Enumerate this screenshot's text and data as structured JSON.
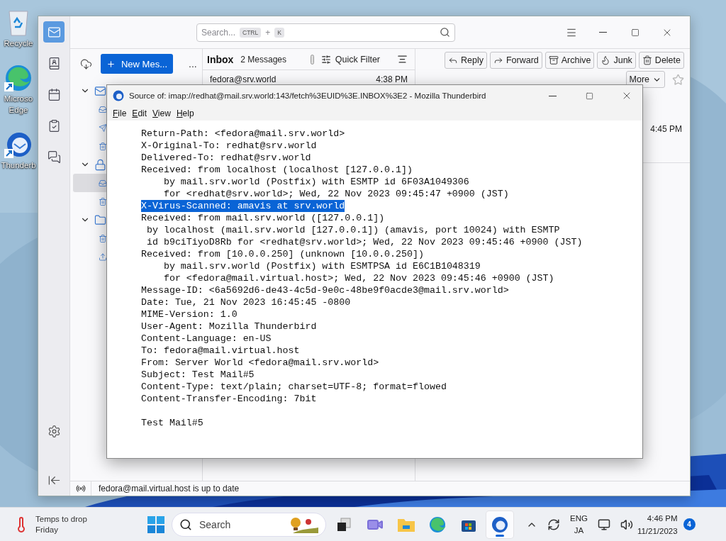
{
  "desktop_icons": [
    {
      "kind": "recycle",
      "lines": [
        "Recycle"
      ]
    },
    {
      "kind": "edge",
      "lines": [
        "Microso",
        "Edge"
      ]
    },
    {
      "kind": "thunderbird",
      "lines": [
        "Thunderb"
      ]
    }
  ],
  "main_window": {
    "spaces": [
      {
        "kind": "mail",
        "selected": true
      },
      {
        "kind": "address-book",
        "selected": false
      },
      {
        "kind": "calendar",
        "selected": false
      },
      {
        "kind": "tasks",
        "selected": false
      },
      {
        "kind": "chat",
        "selected": false
      }
    ],
    "search": {
      "placeholder": "Search...",
      "shortcut": [
        "CTRL",
        "+",
        "K"
      ]
    },
    "new_message": "New Mes...",
    "more": "...",
    "folders": [
      {
        "kind": "account",
        "expanded": true,
        "children": [
          {
            "kind": "inbox",
            "selected": false
          },
          {
            "kind": "sent",
            "selected": false
          },
          {
            "kind": "trash",
            "selected": false
          }
        ]
      },
      {
        "kind": "secure-account",
        "expanded": true,
        "children": [
          {
            "kind": "inbox",
            "selected": true
          },
          {
            "kind": "trash",
            "selected": false
          }
        ]
      },
      {
        "kind": "local-folders",
        "expanded": true,
        "children": [
          {
            "kind": "trash",
            "selected": false
          },
          {
            "kind": "outbox",
            "selected": false
          }
        ]
      }
    ],
    "list": {
      "title": "Inbox",
      "count": "2 Messages",
      "quick_filter": "Quick Filter",
      "quick_filter_on": false,
      "rows": [
        {
          "from": "fedora@srv.world",
          "time": "4:38 PM"
        }
      ]
    },
    "actions": [
      {
        "kind": "reply",
        "label": "Reply"
      },
      {
        "kind": "forward",
        "label": "Forward"
      },
      {
        "kind": "archive",
        "label": "Archive"
      },
      {
        "kind": "junk",
        "label": "Junk"
      },
      {
        "kind": "delete",
        "label": "Delete"
      }
    ],
    "more_menu": "More",
    "starred": false,
    "date": "4:45 PM",
    "status": "fedora@mail.virtual.host is up to date"
  },
  "dialog": {
    "title": "Source of: imap://redhat@mail.srv.world:143/fetch%3EUID%3E.INBOX%3E2 - Mozilla Thunderbird",
    "menu": [
      "File",
      "Edit",
      "View",
      "Help"
    ],
    "headers": [
      {
        "text": "Return-Path: <fedora@mail.srv.world>",
        "selected": false
      },
      {
        "text": "X-Original-To: redhat@srv.world",
        "selected": false
      },
      {
        "text": "Delivered-To: redhat@srv.world",
        "selected": false
      },
      {
        "text": "Received: from localhost (localhost [127.0.0.1])",
        "selected": false
      },
      {
        "text": "    by mail.srv.world (Postfix) with ESMTP id 6F03A1049306",
        "selected": false
      },
      {
        "text": "    for <redhat@srv.world>; Wed, 22 Nov 2023 09:45:47 +0900 (JST)",
        "selected": false
      },
      {
        "text": "X-Virus-Scanned: amavis at srv.world",
        "selected": true
      },
      {
        "text": "Received: from mail.srv.world ([127.0.0.1])",
        "selected": false
      },
      {
        "text": " by localhost (mail.srv.world [127.0.0.1]) (amavis, port 10024) with ESMTP",
        "selected": false
      },
      {
        "text": " id b9ciTiyoD8Rb for <redhat@srv.world>; Wed, 22 Nov 2023 09:45:46 +0900 (JST)",
        "selected": false
      },
      {
        "text": "Received: from [10.0.0.250] (unknown [10.0.0.250])",
        "selected": false
      },
      {
        "text": "    by mail.srv.world (Postfix) with ESMTPSA id E6C1B1048319",
        "selected": false
      },
      {
        "text": "    for <fedora@mail.virtual.host>; Wed, 22 Nov 2023 09:45:46 +0900 (JST)",
        "selected": false
      },
      {
        "text": "Message-ID: <6a5692d6-de43-4c5d-9e0c-48be9f0acde3@mail.srv.world>",
        "selected": false
      },
      {
        "text": "Date: Tue, 21 Nov 2023 16:45:45 -0800",
        "selected": false
      },
      {
        "text": "MIME-Version: 1.0",
        "selected": false
      },
      {
        "text": "User-Agent: Mozilla Thunderbird",
        "selected": false
      },
      {
        "text": "Content-Language: en-US",
        "selected": false
      },
      {
        "text": "To: fedora@mail.virtual.host",
        "selected": false
      },
      {
        "text": "From: Server World <fedora@mail.srv.world>",
        "selected": false
      },
      {
        "text": "Subject: Test Mail#5",
        "selected": false
      },
      {
        "text": "Content-Type: text/plain; charset=UTF-8; format=flowed",
        "selected": false
      },
      {
        "text": "Content-Transfer-Encoding: 7bit",
        "selected": false
      }
    ],
    "body": [
      {
        "text": "Test Mail#5",
        "selected": false
      }
    ]
  },
  "taskbar": {
    "weather": [
      "Temps to drop",
      "Friday"
    ],
    "search_placeholder": "Search",
    "apps": [
      {
        "kind": "task-view",
        "selected": false
      },
      {
        "kind": "meet",
        "selected": false
      },
      {
        "kind": "explorer",
        "selected": false
      },
      {
        "kind": "edge",
        "selected": false
      },
      {
        "kind": "store",
        "selected": false
      },
      {
        "kind": "thunderbird",
        "selected": true
      }
    ],
    "language": [
      "ENG",
      "JA"
    ],
    "time": "4:46 PM",
    "date": "11/21/2023",
    "notifications": "4"
  }
}
